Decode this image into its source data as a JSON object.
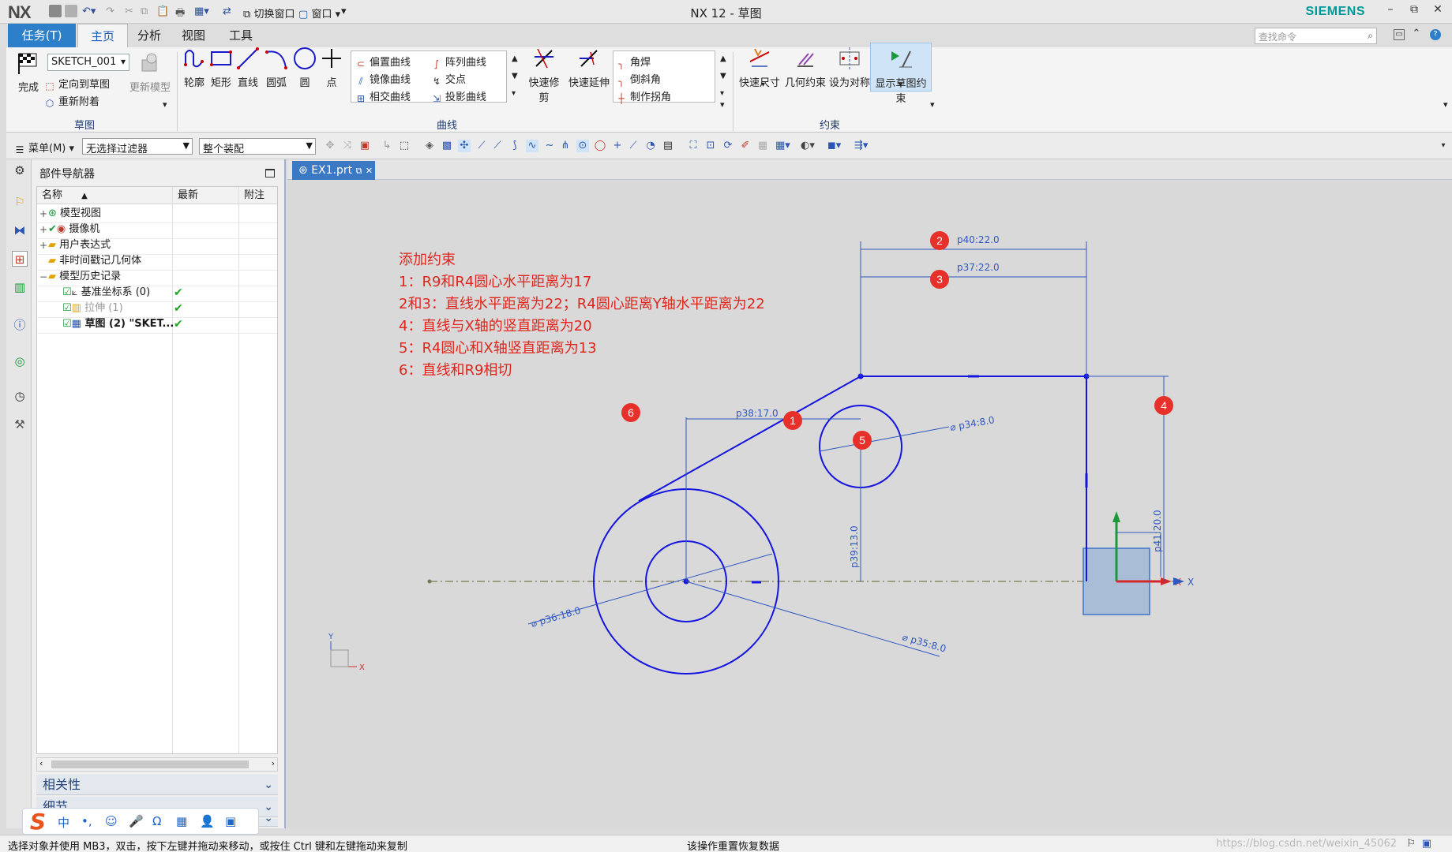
{
  "titlebar": {
    "logo": "NX",
    "switch_window": "切换窗口",
    "window_menu": "窗口",
    "title": "NX 12 - 草图",
    "brand": "SIEMENS"
  },
  "tabs": {
    "task": "任务(T)",
    "items": [
      "主页",
      "分析",
      "视图",
      "工具"
    ],
    "active": "主页"
  },
  "command_search": {
    "placeholder": "查找命令"
  },
  "ribbon": {
    "sketch_group": {
      "finish": "完成",
      "sketch_name": "SKETCH_001",
      "orient_to_sketch": "定向到草图",
      "reattach": "重新附着",
      "update_model": "更新模型",
      "label": "草图"
    },
    "draw": [
      "轮廓",
      "矩形",
      "直线",
      "圆弧",
      "圆",
      "点"
    ],
    "curve_group": {
      "items": [
        "偏置曲线",
        "阵列曲线",
        "镜像曲线",
        "交点",
        "相交曲线",
        "投影曲线"
      ],
      "quick_trim": "快速修剪",
      "quick_extend": "快速延伸",
      "corner_items": [
        "角焊",
        "倒斜角",
        "制作拐角"
      ],
      "label": "曲线"
    },
    "constraint_group": {
      "items": [
        "快速尺寸",
        "几何约束",
        "设为对称",
        "显示草图约束"
      ],
      "label": "约束"
    }
  },
  "toolbar2": {
    "menu": "菜单(M)",
    "filter": "无选择过滤器",
    "assembly": "整个装配"
  },
  "navigator": {
    "title": "部件导航器",
    "columns": [
      "名称",
      "最新",
      "附注"
    ],
    "rows": [
      {
        "label": "模型视图",
        "level": 0,
        "exp": "+",
        "check": ""
      },
      {
        "label": "摄像机",
        "level": 0,
        "exp": "+",
        "check": ""
      },
      {
        "label": "用户表达式",
        "level": 0,
        "exp": "+",
        "check": ""
      },
      {
        "label": "非时间戳记几何体",
        "level": 0,
        "exp": "",
        "check": ""
      },
      {
        "label": "模型历史记录",
        "level": 0,
        "exp": "−",
        "check": ""
      },
      {
        "label": "基准坐标系 (0)",
        "level": 1,
        "exp": "",
        "check": "✔"
      },
      {
        "label": "拉伸 (1)",
        "level": 1,
        "exp": "",
        "check": "✔"
      },
      {
        "label": "草图 (2) \"SKET...",
        "level": 1,
        "exp": "",
        "check": "✔"
      }
    ],
    "panels": [
      "相关性",
      "细节",
      ""
    ]
  },
  "ime": {
    "items": [
      "中",
      "•,",
      "☺",
      "🎤",
      "Ω",
      "▦",
      "👤",
      "▣"
    ]
  },
  "graphics": {
    "tab": "EX1.prt",
    "notes": [
      "添加约束",
      "1：R9和R4圆心水平距离为17",
      "2和3：直线水平距离为22；R4圆心距离Y轴水平距离为22",
      "4：直线与X轴的竖直距离为20",
      "5：R4圆心和X轴竖直距离为13",
      "6：直线和R9相切"
    ],
    "markers": [
      "1",
      "2",
      "3",
      "4",
      "5",
      "6"
    ],
    "dimensions": {
      "p40": "p40:22.0",
      "p37": "p37:22.0",
      "p34": "⌀ p34:8.0",
      "p38": "p38:17.0",
      "p39": "p39:13.0",
      "p41": "p41:20.0",
      "p36": "⌀ p36:18.0",
      "p35": "⌀ p35:8.0"
    },
    "axis_x": "X",
    "axis_y": "Y",
    "colors": {
      "sketch": "#1515e0",
      "dim": "#2f57c0",
      "note": "#e0261c",
      "axis_x": "#d22a2a",
      "axis_y": "#1b9a3b"
    }
  },
  "status": {
    "left": "选择对象并使用 MB3，双击，按下左键并拖动来移动，或按住 Ctrl 键和左键拖动来复制",
    "mid": "该操作重置恢复数据",
    "watermark": "https://blog.csdn.net/weixin_45062"
  }
}
